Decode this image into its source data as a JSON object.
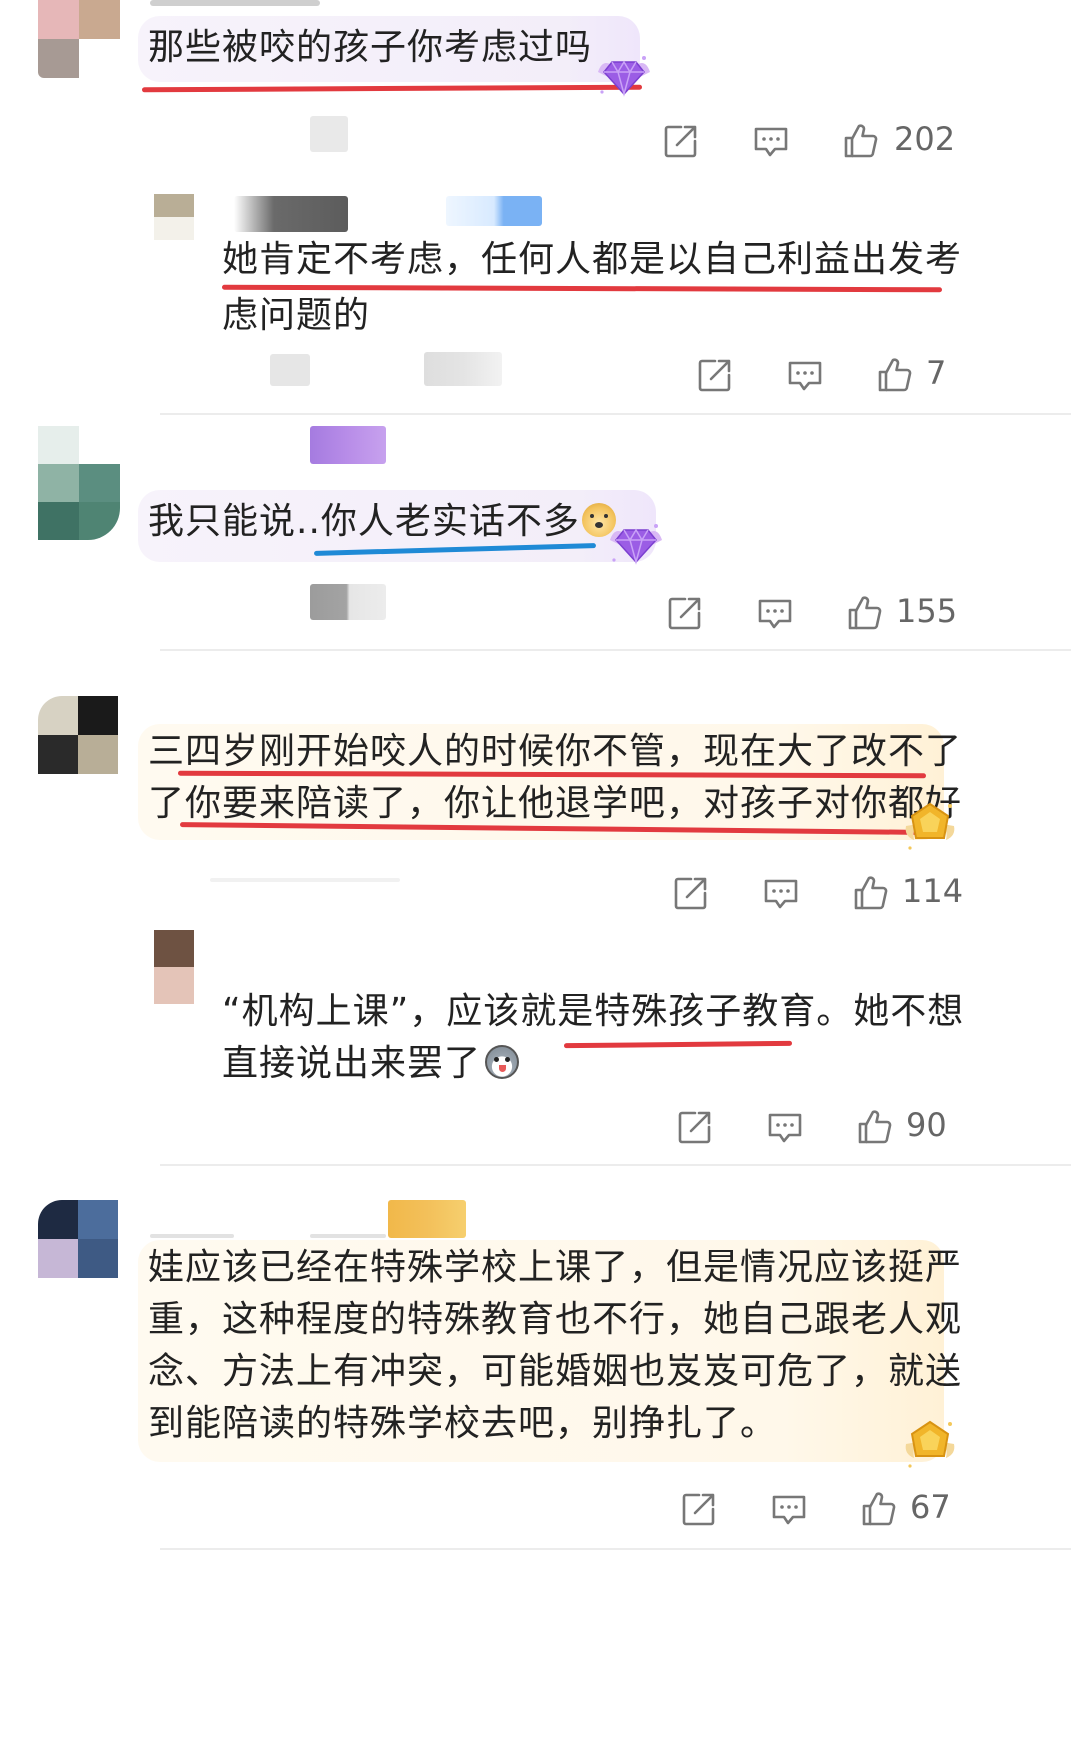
{
  "comments": [
    {
      "id": "c1",
      "text_lines": [
        "那些被咬的孩子你考虑过吗"
      ],
      "likes": "202",
      "badge": "purple-diamond-badge"
    },
    {
      "id": "r1",
      "text_lines": [
        "她肯定不考虑，任何人都是以自己利益出发考",
        "虑问题的"
      ],
      "likes": "7"
    },
    {
      "id": "c2",
      "text_lines": [
        "我只能说..你人老实话不多"
      ],
      "emoji": "doge-emoji",
      "likes": "155",
      "badge": "purple-diamond-badge"
    },
    {
      "id": "c3",
      "text_lines": [
        "三四岁刚开始咬人的时候你不管，现在大了改不了",
        "了你要来陪读了，你让他退学吧，对孩子对你都好"
      ],
      "likes": "114",
      "badge": "gold-medal-badge"
    },
    {
      "id": "r2",
      "text_lines": [
        "“机构上课”，应该就是特殊孩子教育。她不想",
        "直接说出来罢了"
      ],
      "emoji": "husky-emoji",
      "likes": "90"
    },
    {
      "id": "c4",
      "text_lines": [
        "娃应该已经在特殊学校上课了，但是情况应该挺严",
        "重，这种程度的特殊教育也不行，她自己跟老人观",
        "念、方法上有冲突，可能婚姻也岌岌可危了，就送",
        "到能陪读的特殊学校去吧，别挣扎了。"
      ],
      "likes": "67",
      "badge": "gold-medal-badge"
    }
  ],
  "colors": {
    "underline_red": "#e23a3f",
    "underline_blue": "#1f8ad6",
    "icon_gray": "#777777"
  },
  "icons": {
    "share": "share-icon",
    "comment": "comment-icon",
    "like": "thumbs-up-icon"
  }
}
